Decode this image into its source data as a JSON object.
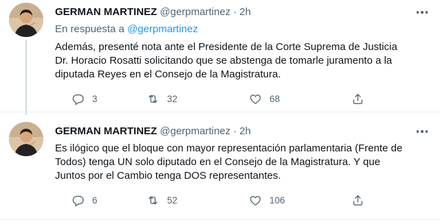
{
  "tweets": [
    {
      "name": "GERMAN MARTINEZ",
      "handle": "@gerpmartinez",
      "separator": "·",
      "time": "2h",
      "reply_prefix": "En respuesta a",
      "reply_handle": "@gerpmartinez",
      "text_lines": [
        "Además, presenté nota ante el Presidente de la Corte Suprema de Justicia",
        "Dr. Horacio Rosatti solicitando que se abstenga de tomarle juramento a la",
        "diputada Reyes en el Consejo de la Magistratura."
      ],
      "replies": "3",
      "retweets": "32",
      "likes": "68"
    },
    {
      "name": "GERMAN MARTINEZ",
      "handle": "@gerpmartinez",
      "separator": "·",
      "time": "2h",
      "text_lines": [
        "Es ilógico que el bloque con mayor representación parlamentaria (Frente de",
        "Todos) tenga UN solo diputado en el Consejo de la Magistratura. Y que",
        "Juntos por el Cambio tenga DOS representantes."
      ],
      "replies": "6",
      "retweets": "52",
      "likes": "106"
    }
  ],
  "icons": {
    "reply": "reply-icon",
    "retweet": "retweet-icon",
    "like": "heart-icon",
    "share": "share-icon",
    "more": "more-options-icon"
  },
  "colors": {
    "text": "#0f1419",
    "secondary": "#536471",
    "link": "#1d9bf0",
    "divider": "#e6ecf0"
  }
}
